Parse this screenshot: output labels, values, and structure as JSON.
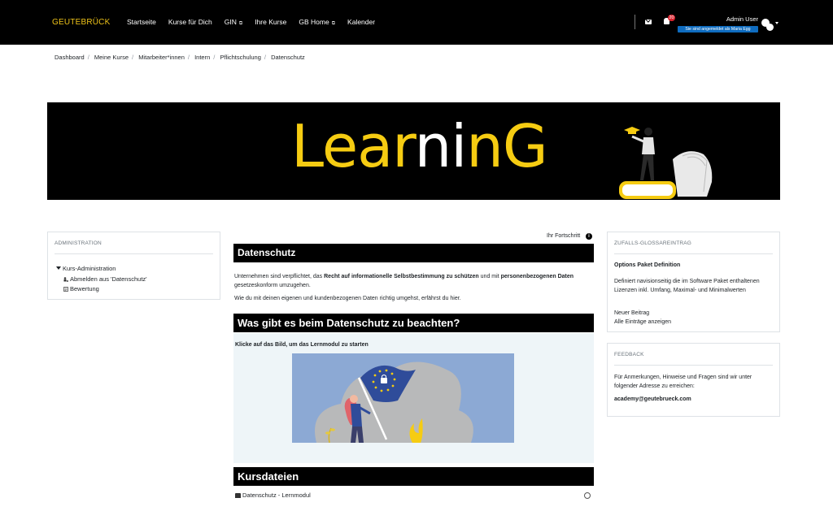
{
  "navbar": {
    "brand": "GEUTEBRÜCK",
    "links": [
      {
        "label": "Startseite",
        "external": false
      },
      {
        "label": "Kurse für Dich",
        "external": false
      },
      {
        "label": "GIN",
        "external": true
      },
      {
        "label": "Ihre Kurse",
        "external": false
      },
      {
        "label": "GB Home",
        "external": true
      },
      {
        "label": "Kalender",
        "external": false
      }
    ],
    "external_glyph": "⧉",
    "notification_count": "20",
    "user_name": "Admin User",
    "login_as_badge": "Sie sind angemeldet als Maria Egg"
  },
  "breadcrumb": [
    "Dashboard",
    "Meine Kurse",
    "Mitarbeiter*innen",
    "Intern",
    "Pflichtschulung",
    "Datenschutz"
  ],
  "banner": {
    "title_part1": "Lear",
    "title_part2": "ni",
    "title_part3": "nG"
  },
  "admin_block": {
    "title": "ADMINISTRATION",
    "root_label": "Kurs-Administration",
    "items": [
      "Abmelden aus 'Datenschutz'",
      "Bewertung"
    ]
  },
  "course": {
    "progress_label": "Ihr Fortschritt",
    "section1_title": "Datenschutz",
    "intro_part1": "Unternehmen sind verpflichtet, das ",
    "intro_bold1": "Recht auf informationelle Selbstbestimmung zu schützen",
    "intro_part2": " und mit ",
    "intro_bold2": "personenbezogenen Daten",
    "intro_part3": " gesetzeskonform umzugehen.",
    "intro_line2": "Wie du mit deinen eigenen und kundenbezogenen Daten richtig umgehst, erfährst du hier.",
    "section2_title": "Was gibt es beim Datenschutz zu beachten?",
    "module_hint": "Klicke auf das Bild, um das Lernmodul zu starten",
    "section3_title": "Kursdateien",
    "file_label": "Datenschutz - Lernmodul"
  },
  "glossary_block": {
    "title": "ZUFALLS-GLOSSAREINTRAG",
    "entry_title": "Options Paket Definition",
    "entry_text": "Definiert navisionseitig die im Software Paket enthaltenen Lizenzen inkl. Umfang, Maximal- und Minimalwerten",
    "new_entry": "Neuer Beitrag",
    "show_all": "Alle Einträge anzeigen"
  },
  "feedback_block": {
    "title": "FEEDBACK",
    "text": "Für Anmerkungen, Hinweise und Fragen sind wir unter folgender Adresse zu erreichen:",
    "email": "academy@geutebrueck.com"
  },
  "colors": {
    "brand_yellow": "#f0c419",
    "badge_red": "#d9232e",
    "login_blue": "#0f6cbf"
  }
}
